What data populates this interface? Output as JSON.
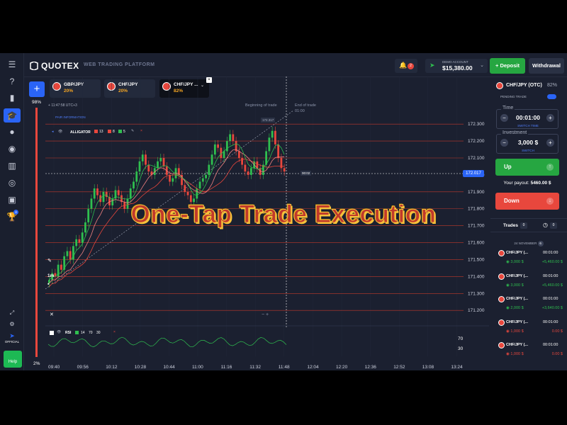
{
  "header": {
    "brand": "QUOTEX",
    "platform": "WEB TRADING PLATFORM",
    "notifications": "2",
    "account_label": "DEMO ACCOUNT",
    "balance": "$15,380.00",
    "deposit": "Deposit",
    "withdrawal": "Withdrawal"
  },
  "sidebar": {
    "icons": [
      "menu-icon",
      "help-icon",
      "chart-icon",
      "education-icon",
      "user-icon",
      "dollar-icon",
      "analytics-icon",
      "signal-icon",
      "copy-icon",
      "trophy-icon"
    ],
    "trophy_badge": "4",
    "official": "OFFICIAL",
    "help": "Help"
  },
  "asset_tabs": [
    {
      "name": "GBP/JPY",
      "pct": "20%"
    },
    {
      "name": "CHF/JPY",
      "pct": "20%"
    },
    {
      "name": "CHF/JPY ...",
      "pct": "82%"
    }
  ],
  "progress": {
    "top": "98%",
    "bottom": "2%"
  },
  "chart": {
    "clock": "11:47:58",
    "timezone": "UTC+3",
    "pair_info": "PAIR INFORMATION",
    "alligator_label": "ALLIGATOR",
    "alligator_params": [
      "13",
      "8",
      "5"
    ],
    "beginning_label": "Beginning of trade",
    "end_label": "End of trade",
    "end_time": "01:00",
    "price_tag": "172.017",
    "countdown": "00:02",
    "top_label": "172.317",
    "timeframe": "1m",
    "rsi_label": "RSI",
    "rsi_params": [
      "14",
      "70",
      "30"
    ],
    "rsi_levels": [
      "70",
      "30"
    ]
  },
  "chart_data": {
    "type": "candlestick",
    "title": "",
    "ylim": [
      171.18,
      172.33
    ],
    "y_ticks": [
      "172.300",
      "172.200",
      "172.100",
      "172.000",
      "171.900",
      "171.800",
      "171.700",
      "171.600",
      "171.500",
      "171.400",
      "171.300",
      "171.200"
    ],
    "x_ticks": [
      "09:40",
      "09:56",
      "10:12",
      "10:28",
      "10:44",
      "11:00",
      "11:16",
      "11:32",
      "11:48",
      "12:04",
      "12:20",
      "12:36",
      "12:52",
      "13:08",
      "13:24"
    ],
    "current_price": 172.017,
    "series": [
      {
        "name": "alligator-13",
        "color": "#e8473d"
      },
      {
        "name": "alligator-8",
        "color": "#e8473d"
      },
      {
        "name": "alligator-5",
        "color": "#2fbf4f"
      }
    ],
    "candles_close": [
      171.38,
      171.42,
      171.4,
      171.47,
      171.44,
      171.52,
      171.55,
      171.5,
      171.58,
      171.62,
      171.6,
      171.66,
      171.72,
      171.8,
      171.86,
      171.92,
      171.88,
      171.84,
      171.9,
      171.87,
      171.82,
      171.86,
      171.91,
      171.88,
      171.84,
      171.8,
      171.86,
      171.92,
      171.96,
      172.02,
      172.08,
      172.12,
      172.06,
      172.02,
      172.0,
      172.04,
      172.08,
      172.1,
      172.05,
      172.0,
      171.96,
      171.98,
      172.04,
      172.0,
      171.94,
      171.9,
      171.88,
      171.84,
      171.86,
      171.92,
      171.96,
      171.98,
      172.0,
      172.06,
      172.12,
      172.18,
      172.16,
      172.1,
      172.14,
      172.2,
      172.24,
      172.2,
      172.14,
      172.1,
      172.06,
      172.02,
      172.0,
      172.04,
      172.08,
      172.04,
      172.0,
      172.06,
      172.14,
      172.22,
      172.26,
      172.18,
      172.1,
      172.04,
      172.02
    ]
  },
  "panel": {
    "asset": "CHF/JPY (OTC)",
    "asset_pct": "82%",
    "pending": "PENDING TRADE",
    "time_label": "Time",
    "time_value": "00:01:00",
    "switch_time": "SWITCH TIME",
    "investment_label": "Investment",
    "investment_value": "3,000 $",
    "switch": "SWITCH",
    "up": "Up",
    "payout_label": "Your payout:",
    "payout_value": "5460.00 $",
    "down": "Down",
    "trades_title": "Trades",
    "trades_count": "0",
    "trades_date": "24 NOVEMBER",
    "trades_date_count": "6",
    "trades": [
      {
        "name": "CHF/JPY (...",
        "time": "00:01:00",
        "amount": "3,000 $",
        "result": "+5,460.00 $",
        "win": true
      },
      {
        "name": "CHF/JPY (...",
        "time": "00:01:00",
        "amount": "3,000 $",
        "result": "+5,460.00 $",
        "win": true
      },
      {
        "name": "CHF/JPY (...",
        "time": "00:01:00",
        "amount": "2,000 $",
        "result": "+3,640.00 $",
        "win": true
      },
      {
        "name": "CHF/JPY (...",
        "time": "00:01:00",
        "amount": "1,000 $",
        "result": "0.00 $",
        "win": false
      },
      {
        "name": "CHF/JPY (...",
        "time": "00:01:00",
        "amount": "1,000 $",
        "result": "0.00 $",
        "win": false
      }
    ]
  },
  "overlay": {
    "headline": "One-Tap Trade Execution"
  }
}
